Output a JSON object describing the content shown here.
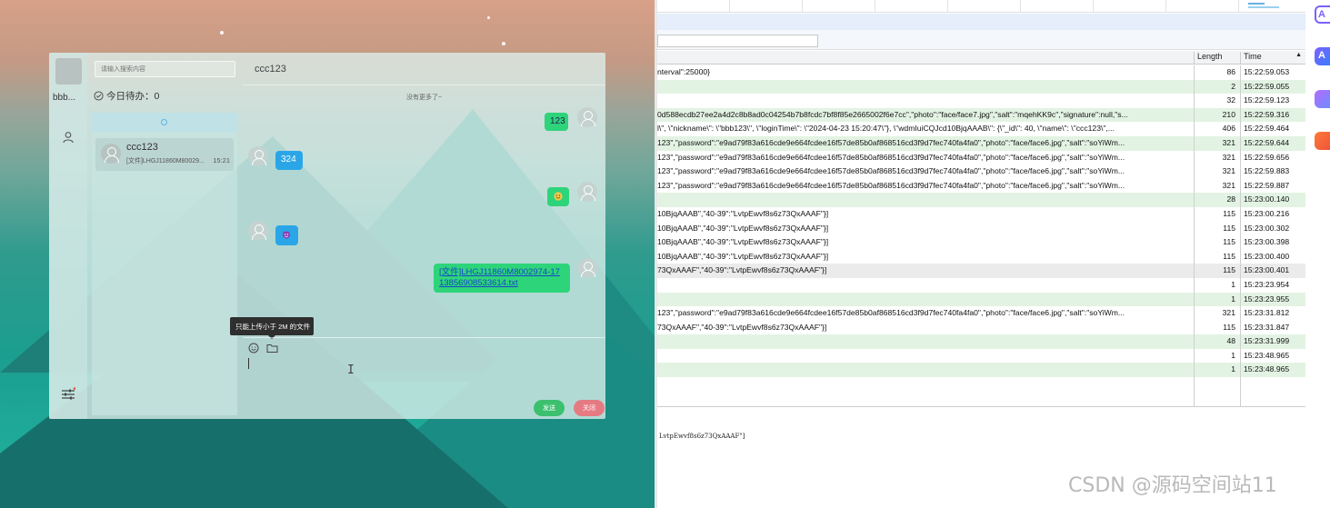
{
  "chat": {
    "self_name": "bbb...",
    "search_placeholder": "请输入搜索内容",
    "todo_label": "今日待办：0",
    "contact": {
      "name": "ccc123",
      "preview": "[文件]LHGJ11860M80029...",
      "time": "15:21"
    },
    "conversation_title": "ccc123",
    "no_more": "没有更多了~",
    "messages": [
      {
        "side": "right",
        "type": "text",
        "text": "123"
      },
      {
        "side": "left",
        "type": "text",
        "text": "324"
      },
      {
        "side": "right",
        "type": "emoji",
        "emoji": "grin-emoji"
      },
      {
        "side": "left",
        "type": "emoji",
        "emoji": "devil-emoji"
      },
      {
        "side": "right",
        "type": "file",
        "text": "[文件]LHGJ11860M8002974-1713856908533614.txt"
      }
    ],
    "upload_tooltip": "只能上传小于 2M 的文件",
    "send_label": "发送",
    "close_label": "关闭",
    "colors": {
      "outgoing": "#2ed47a",
      "incoming": "#2aa6e8",
      "send": "#3cc06e",
      "close": "#e57a82"
    }
  },
  "network": {
    "columns": {
      "length": "Length",
      "time": "Time"
    },
    "rows": [
      {
        "data": "nterval\":25000}",
        "length": "86",
        "time": "15:22:59.053",
        "style": "plain"
      },
      {
        "data": "",
        "length": "2",
        "time": "15:22:59.055",
        "style": "green"
      },
      {
        "data": "",
        "length": "32",
        "time": "15:22:59.123",
        "style": "plain"
      },
      {
        "data": "0d588ecdb27ee2a4d2c8b8ad0c04254b7b8fcdc7bf8f85e2665002f6e7cc\",\"photo\":\"face/face7.jpg\",\"salt\":\"mqehKK9c\",\"signature\":null,\"s...",
        "length": "210",
        "time": "15:22:59.316",
        "style": "green"
      },
      {
        "data": "l\\\", \\\"nickname\\\": \\\"bbb123\\\", \\\"loginTime\\\": \\\"2024-04-23 15:20:47\\\"}, \\\"wdmIuiCQJcd10BjqAAAB\\\": {\\\"_id\\\": 40, \\\"name\\\": \\\"ccc123\\\",...",
        "length": "406",
        "time": "15:22:59.464",
        "style": "plain"
      },
      {
        "data": "123\",\"password\":\"e9ad79f83a616cde9e664fcdee16f57de85b0af868516cd3f9d7fec740fa4fa0\",\"photo\":\"face/face6.jpg\",\"salt\":\"soYiWm...",
        "length": "321",
        "time": "15:22:59.644",
        "style": "green"
      },
      {
        "data": "123\",\"password\":\"e9ad79f83a616cde9e664fcdee16f57de85b0af868516cd3f9d7fec740fa4fa0\",\"photo\":\"face/face6.jpg\",\"salt\":\"soYiWm...",
        "length": "321",
        "time": "15:22:59.656",
        "style": "plain"
      },
      {
        "data": "123\",\"password\":\"e9ad79f83a616cde9e664fcdee16f57de85b0af868516cd3f9d7fec740fa4fa0\",\"photo\":\"face/face6.jpg\",\"salt\":\"soYiWm...",
        "length": "321",
        "time": "15:22:59.883",
        "style": "plain"
      },
      {
        "data": "123\",\"password\":\"e9ad79f83a616cde9e664fcdee16f57de85b0af868516cd3f9d7fec740fa4fa0\",\"photo\":\"face/face6.jpg\",\"salt\":\"soYiWm...",
        "length": "321",
        "time": "15:22:59.887",
        "style": "plain"
      },
      {
        "data": "",
        "length": "28",
        "time": "15:23:00.140",
        "style": "green"
      },
      {
        "data": "10BjqAAAB\",\"40-39\":\"LvtpEwvf8s6z73QxAAAF\"}]",
        "length": "115",
        "time": "15:23:00.216",
        "style": "plain"
      },
      {
        "data": "10BjqAAAB\",\"40-39\":\"LvtpEwvf8s6z73QxAAAF\"}]",
        "length": "115",
        "time": "15:23:00.302",
        "style": "plain"
      },
      {
        "data": "10BjqAAAB\",\"40-39\":\"LvtpEwvf8s6z73QxAAAF\"}]",
        "length": "115",
        "time": "15:23:00.398",
        "style": "plain"
      },
      {
        "data": "10BjqAAAB\",\"40-39\":\"LvtpEwvf8s6z73QxAAAF\"}]",
        "length": "115",
        "time": "15:23:00.400",
        "style": "plain"
      },
      {
        "data": "73QxAAAF\",\"40-39\":\"LvtpEwvf8s6z73QxAAAF\"}]",
        "length": "115",
        "time": "15:23:00.401",
        "style": "sel"
      },
      {
        "data": "",
        "length": "1",
        "time": "15:23:23.954",
        "style": "plain"
      },
      {
        "data": "",
        "length": "1",
        "time": "15:23:23.955",
        "style": "green"
      },
      {
        "data": "123\",\"password\":\"e9ad79f83a616cde9e664fcdee16f57de85b0af868516cd3f9d7fec740fa4fa0\",\"photo\":\"face/face6.jpg\",\"salt\":\"soYiWm...",
        "length": "321",
        "time": "15:23:31.812",
        "style": "plain"
      },
      {
        "data": "73QxAAAF\",\"40-39\":\"LvtpEwvf8s6z73QxAAAF\"}]",
        "length": "115",
        "time": "15:23:31.847",
        "style": "plain"
      },
      {
        "data": "",
        "length": "48",
        "time": "15:23:31.999",
        "style": "green"
      },
      {
        "data": "",
        "length": "1",
        "time": "15:23:48.965",
        "style": "plain"
      },
      {
        "data": "",
        "length": "1",
        "time": "15:23:48.965",
        "style": "green"
      }
    ],
    "preview_text": "LvtpEwvf8s6z73QxAAAF\"]",
    "colors": {
      "green_row": "#e3f3e3",
      "selected_row": "#ebebeb"
    }
  },
  "dock": [
    {
      "icon": "ai-circle-icon",
      "color": "#7b61ff"
    },
    {
      "icon": "ai-square-icon",
      "color": "#3a7bff"
    },
    {
      "icon": "copilot-icon",
      "color": "#b46cff"
    },
    {
      "icon": "red-app-icon",
      "color": "#f0553a"
    }
  ],
  "watermark": "CSDN @源码空间站11"
}
